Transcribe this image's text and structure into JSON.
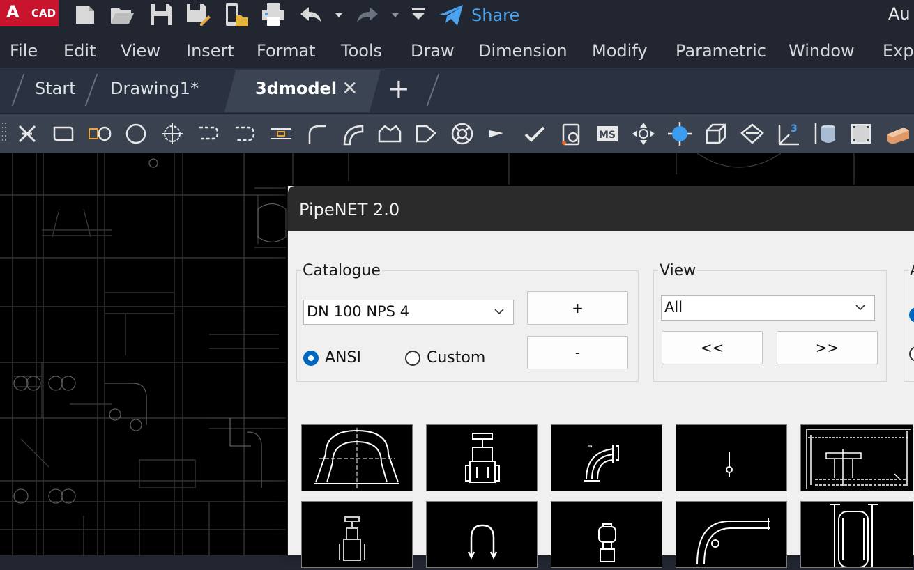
{
  "app": {
    "logo_letter": "A",
    "logo_text": "CAD",
    "title_partial": "Au",
    "brand_color": "#c8142d"
  },
  "quick_access": {
    "share_label": "Share"
  },
  "menu": [
    "File",
    "Edit",
    "View",
    "Insert",
    "Format",
    "Tools",
    "Draw",
    "Dimension",
    "Modify",
    "Parametric",
    "Window",
    "Expr"
  ],
  "tabs": {
    "start": "Start",
    "drawing": "Drawing1*",
    "active": "3dmodel",
    "close_glyph": "✕",
    "add_glyph": "+"
  },
  "dialog": {
    "title": "PipeNET 2.0",
    "catalogue": {
      "label": "Catalogue",
      "size_value": "DN 100 NPS 4",
      "add_label": "+",
      "remove_label": "-",
      "radio_ansi": "ANSI",
      "radio_custom": "Custom",
      "selected": "ANSI"
    },
    "view": {
      "label": "View",
      "value": "All",
      "prev_label": "<<",
      "next_label": ">>"
    },
    "partial_group_label": "A"
  }
}
